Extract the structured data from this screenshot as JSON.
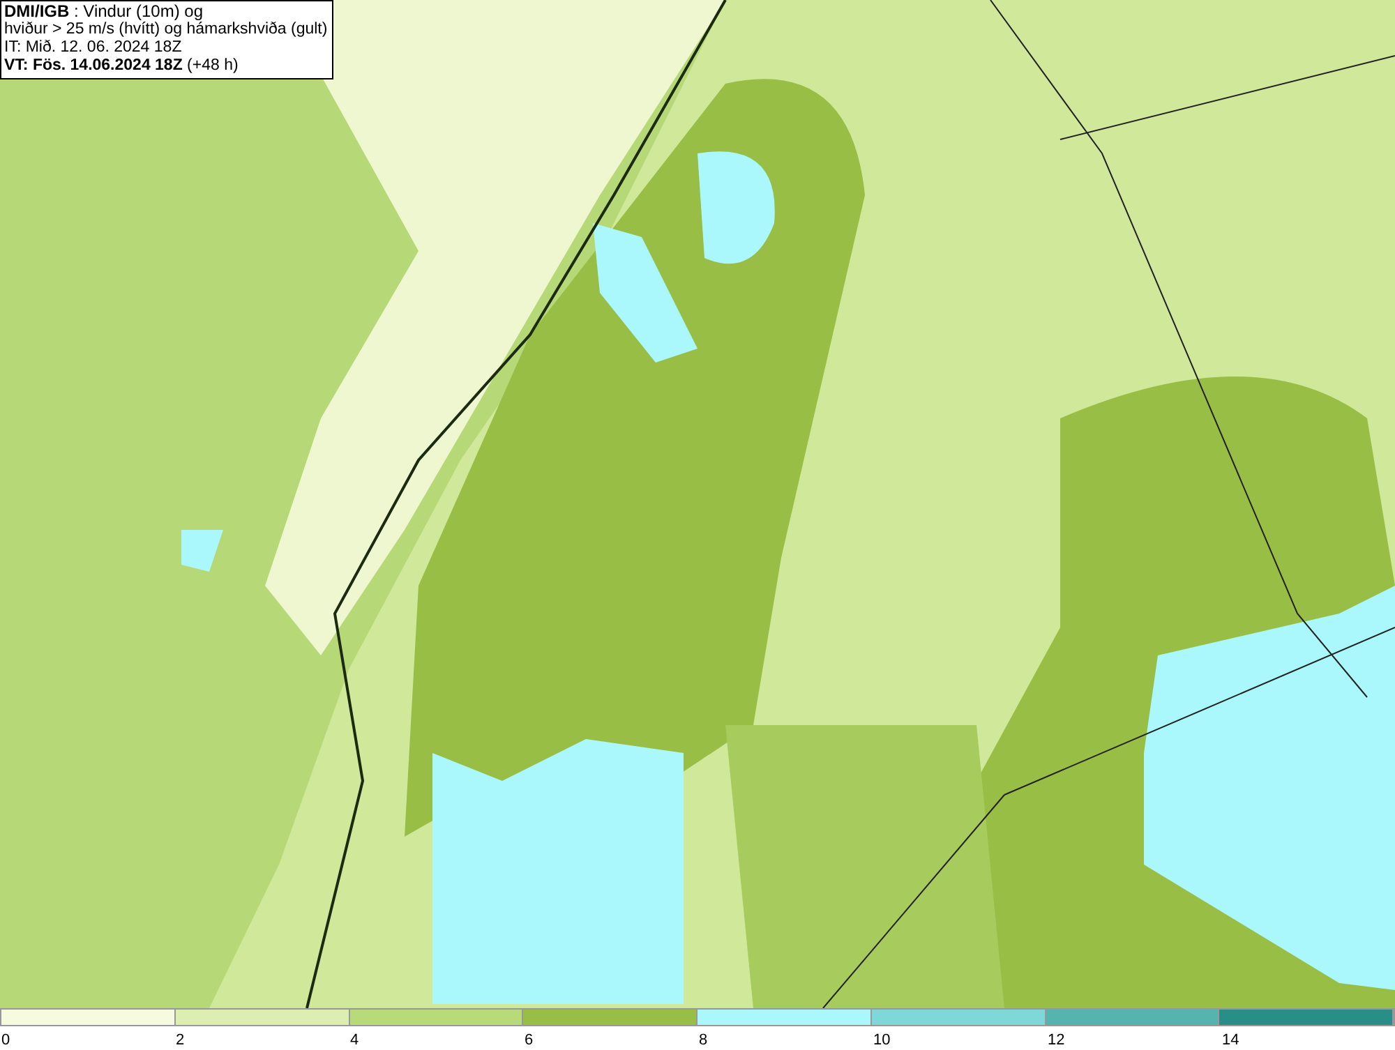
{
  "title_box": {
    "lines": [
      "**DMI/IGB** : Vindur (10m) og",
      "hviður > 25 m/s (hvítt) og hámarkshviða (gult)",
      "IT: Mið. 12. 06. 2024 18Z",
      "**VT: Fös. 14.06.2024 18Z** (+48 h)"
    ]
  },
  "legend": {
    "bins": [
      {
        "label": "0",
        "color": "#f6fbe0"
      },
      {
        "label": "2",
        "color": "#dcefb0"
      },
      {
        "label": "4",
        "color": "#b9da78"
      },
      {
        "label": "6",
        "color": "#98be45"
      },
      {
        "label": "8",
        "color": "#aaf8fb"
      },
      {
        "label": "10",
        "color": "#7fd8d8"
      },
      {
        "label": "12",
        "color": "#55b3b0"
      },
      {
        "label": "14",
        "color": "#2a8e88"
      }
    ]
  }
}
